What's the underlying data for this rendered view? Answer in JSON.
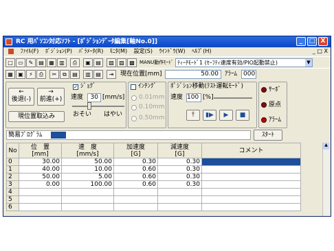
{
  "window": {
    "title": "RC 用ﾊﾟｿｺﾝ対応ｿﾌﾄ - [ﾎﾟｼﾞｼｮﾝﾃﾞｰﾀ編集[軸No.0]]",
    "controls": [
      "_",
      "□",
      "X"
    ]
  },
  "menu": {
    "items": [
      "ﾌｧｲﾙ(F)",
      "ﾎﾟｼﾞｼｮﾝ(P)",
      "ﾊﾟﾗﾒｰﾀ(R)",
      "ﾓﾆﾀ(M)",
      "設定(S)",
      "ｳｲﾝﾄﾞｳ(W)",
      "ﾍﾙﾌﾟ(H)"
    ],
    "mdi_controls": [
      "_",
      "□",
      "X"
    ]
  },
  "toolbar": {
    "mode_label": "MANU動作ﾓｰﾄﾞ",
    "mode_value": "ﾃｨｰﾁﾓｰﾄﾞ1 (ｾｰﾌﾃｨ速度有効/PIO起動禁止)"
  },
  "position": {
    "label": "現在位置[mm]",
    "value": "50.00",
    "alarm_label": "ｱﾗｰﾑ",
    "alarm_value": "000"
  },
  "jog": {
    "back_label": "後退(-)",
    "forward_label": "前進(+)",
    "jog_check_label": "ｼﾞｮｸﾞ",
    "speed_label": "速度",
    "speed_value": "30",
    "speed_unit": "[mm/s]",
    "slow_label": "おそい",
    "fast_label": "はやい",
    "capture_label": "現位置取込み"
  },
  "inching": {
    "label": "ｲﾝﾁﾝｸﾞ",
    "options": [
      "0.01mm",
      "0.10mm",
      "0.50mm"
    ]
  },
  "move": {
    "label": "ﾎﾟｼﾞｼｮﾝ移動(ﾃｽﾄ運転ﾓｰﾄﾞ)",
    "speed_label": "速度",
    "speed_value": "100",
    "speed_unit": "[%]"
  },
  "status": {
    "servo_label": "ｻｰﾎﾞ",
    "home_label": "原点",
    "alarm_label": "ｱﾗｰﾑ"
  },
  "program": {
    "label": "簡易ﾌﾟﾛｸﾞﾗﾑ",
    "start_label": "ｽﾀｰﾄ"
  },
  "table": {
    "headers": [
      "No",
      "位　置\n[mm]",
      "速　度\n[mm/s]",
      "加速度\n[G]",
      "減速度\n[G]",
      "コメント"
    ],
    "rows": [
      [
        "0",
        "30.00",
        "50.00",
        "0.30",
        "0.30",
        ""
      ],
      [
        "1",
        "40.00",
        "10.00",
        "0.60",
        "0.30",
        ""
      ],
      [
        "2",
        "50.00",
        "5.00",
        "0.60",
        "0.30",
        ""
      ],
      [
        "3",
        "0.00",
        "100.00",
        "0.60",
        "0.30",
        ""
      ],
      [
        "4",
        "",
        "",
        "",
        "",
        ""
      ],
      [
        "5",
        "",
        "",
        "",
        "",
        ""
      ],
      [
        "6",
        "",
        "",
        "",
        "",
        ""
      ]
    ]
  }
}
